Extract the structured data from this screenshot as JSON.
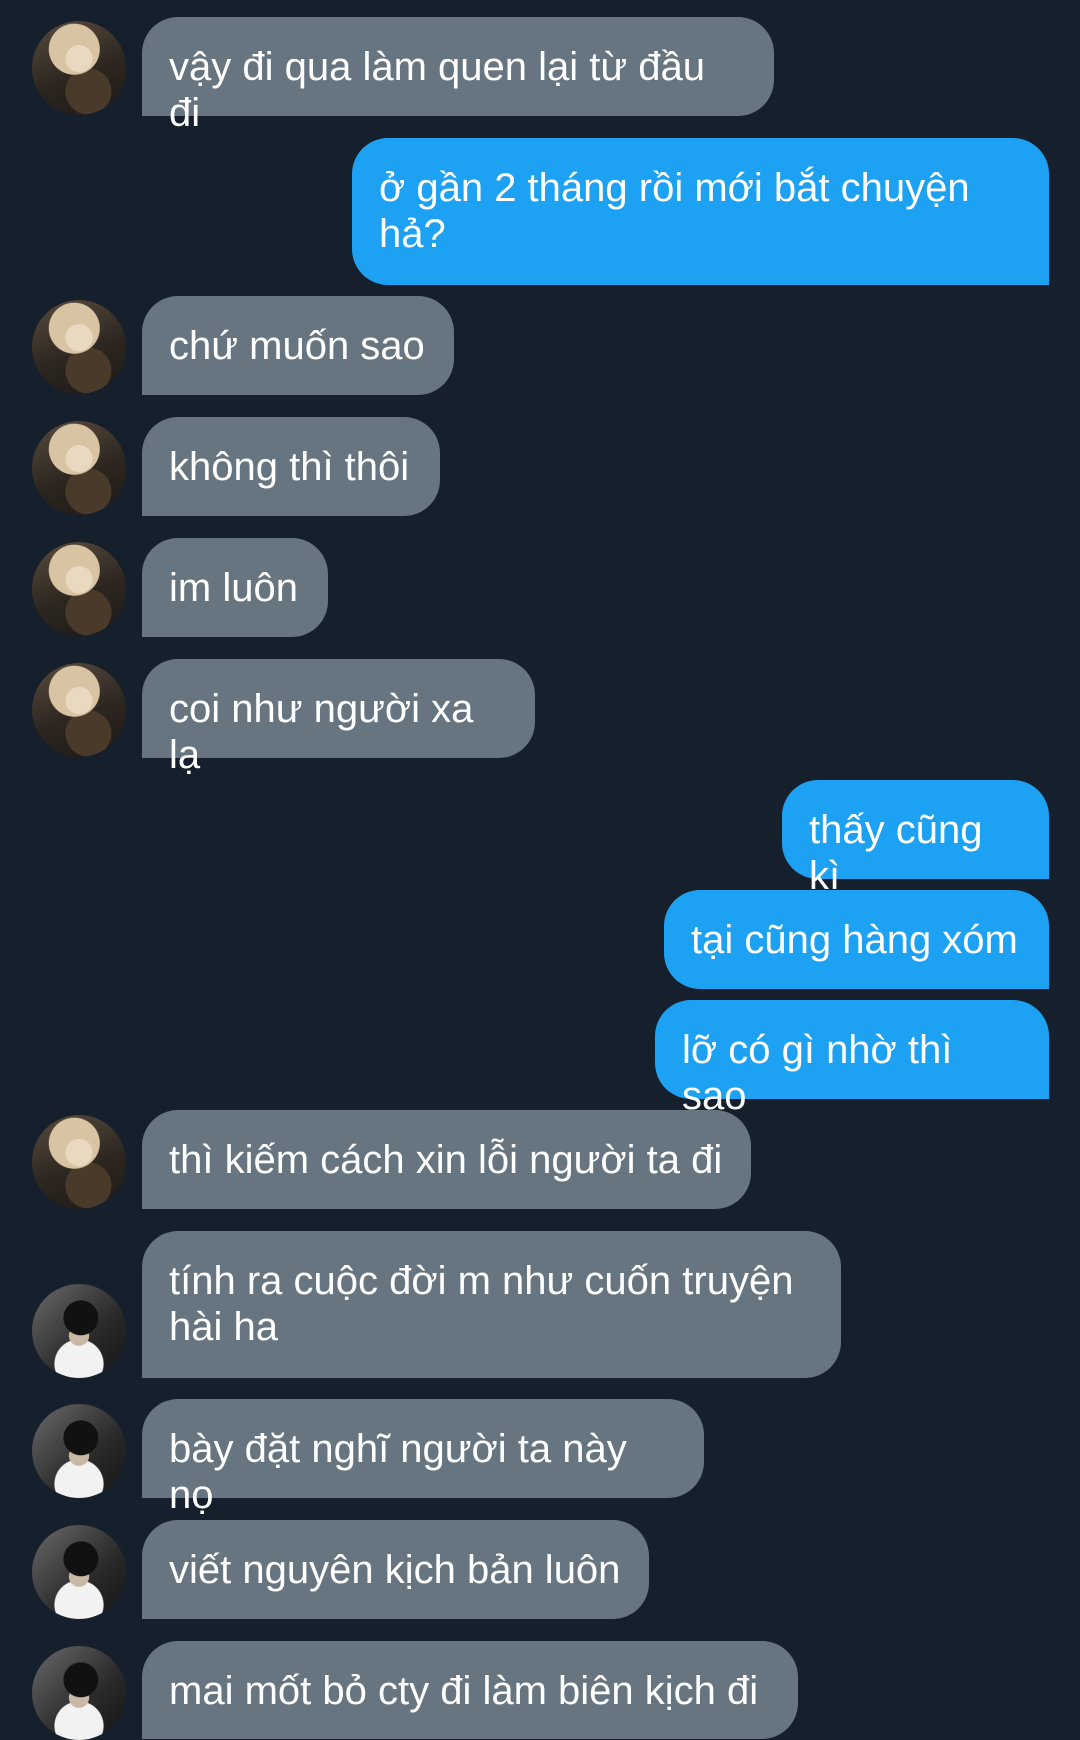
{
  "colors": {
    "background": "#16202c",
    "incoming_bubble": "#66757f",
    "outgoing_bubble": "#1da1f2",
    "text": "#ffffff"
  },
  "messages": [
    {
      "dir": "in",
      "avatar": "profile-photo-1",
      "text": "vậy đi qua làm quen lại từ đầu đi"
    },
    {
      "dir": "out",
      "text": "ở gần 2 tháng rồi mới bắt chuyện hả?"
    },
    {
      "dir": "in",
      "avatar": "profile-photo-1",
      "text": "chứ muốn sao"
    },
    {
      "dir": "in",
      "avatar": "profile-photo-1",
      "text": "không thì thôi"
    },
    {
      "dir": "in",
      "avatar": "profile-photo-1",
      "text": "im luôn"
    },
    {
      "dir": "in",
      "avatar": "profile-photo-1",
      "text": "coi như người xa lạ"
    },
    {
      "dir": "out",
      "text": "thấy cũng kì"
    },
    {
      "dir": "out",
      "text": "tại cũng hàng xóm"
    },
    {
      "dir": "out",
      "text": "lỡ có gì nhờ thì sao"
    },
    {
      "dir": "in",
      "avatar": "profile-photo-1",
      "text": "thì kiếm cách xin lỗi người ta đi"
    },
    {
      "dir": "in",
      "avatar": "profile-photo-2",
      "text": "tính ra cuộc đời m như cuốn truyện hài ha"
    },
    {
      "dir": "in",
      "avatar": "profile-photo-2",
      "text": "bày đặt nghĩ người ta này nọ"
    },
    {
      "dir": "in",
      "avatar": "profile-photo-2",
      "text": "viết nguyên kịch bản luôn"
    },
    {
      "dir": "in",
      "avatar": "profile-photo-2",
      "text": "mai mốt bỏ cty đi làm biên kịch đi"
    }
  ]
}
